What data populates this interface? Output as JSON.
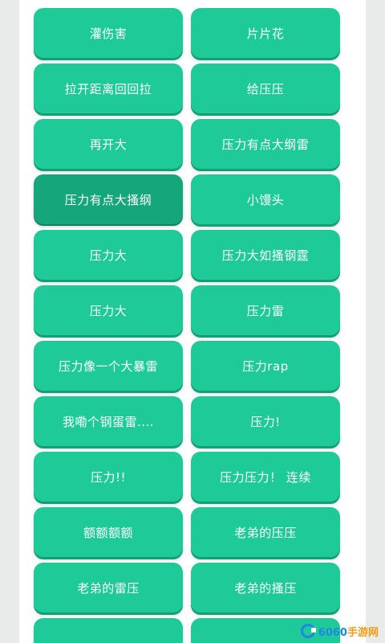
{
  "buttons": [
    {
      "label": "灌伤害",
      "pressed": false
    },
    {
      "label": "片片花",
      "pressed": false
    },
    {
      "label": "拉开距离回回拉",
      "pressed": false
    },
    {
      "label": "给压压",
      "pressed": false
    },
    {
      "label": "再开大",
      "pressed": false
    },
    {
      "label": "压力有点大纲雷",
      "pressed": false
    },
    {
      "label": "压力有点大搔纲",
      "pressed": true
    },
    {
      "label": "小馒头",
      "pressed": false
    },
    {
      "label": "压力大",
      "pressed": false
    },
    {
      "label": "压力大如搔钢霆",
      "pressed": false
    },
    {
      "label": "压力大",
      "pressed": false
    },
    {
      "label": "压力雷",
      "pressed": false
    },
    {
      "label": "压力像一个大暴雷",
      "pressed": false
    },
    {
      "label": "压力rap",
      "pressed": false
    },
    {
      "label": "我嘞个钢蛋雷....",
      "pressed": false
    },
    {
      "label": "压力!",
      "pressed": false
    },
    {
      "label": "压力!!",
      "pressed": false
    },
    {
      "label": "压力压力！ 连续",
      "pressed": false
    },
    {
      "label": "额额额额",
      "pressed": false
    },
    {
      "label": "老弟的压压",
      "pressed": false
    },
    {
      "label": "老弟的雷压",
      "pressed": false
    },
    {
      "label": "老弟的搔压",
      "pressed": false
    },
    {
      "label": "",
      "pressed": false
    },
    {
      "label": "",
      "pressed": false
    }
  ],
  "watermark": {
    "text_blue": "6060",
    "text_orange": "手游网",
    "icon": "logo-c-icon"
  },
  "colors": {
    "button": "#1ecb98",
    "button_pressed": "#16a67c",
    "text": "#ffffff"
  }
}
